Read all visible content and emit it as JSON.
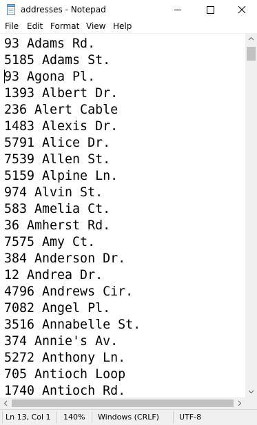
{
  "window": {
    "title": "addresses - Notepad",
    "icons": {
      "app": "notepad-icon",
      "minimize": "minimize-icon",
      "maximize": "maximize-icon",
      "close": "close-icon"
    }
  },
  "menu": {
    "items": [
      "File",
      "Edit",
      "Format",
      "View",
      "Help"
    ]
  },
  "editor": {
    "lines": [
      "93 Adams Rd.",
      "5185 Adams St.",
      "93 Agona Pl.",
      "1393 Albert Dr.",
      "236 Alert Cable",
      "1483 Alexis Dr.",
      "5791 Alice Dr.",
      "7539 Allen St.",
      "5159 Alpine Ln.",
      "974 Alvin St.",
      "583 Amelia Ct.",
      "36 Amherst Rd.",
      "7575 Amy Ct.",
      "384 Anderson Dr.",
      "12 Andrea Dr.",
      "4796 Andrews Cir.",
      "7082 Angel Pl.",
      "3516 Annabelle St.",
      "374 Annie's Av.",
      "5272 Anthony Ln.",
      "705 Antioch Loop",
      "1740 Antioch Rd."
    ]
  },
  "statusbar": {
    "position": "Ln 13, Col 1",
    "zoom": "140%",
    "line_endings": "Windows (CRLF)",
    "encoding": "UTF-8"
  },
  "colors": {
    "chrome": "#f0f0f0",
    "scroll_thumb": "#c1c1c1",
    "text": "#000000"
  }
}
